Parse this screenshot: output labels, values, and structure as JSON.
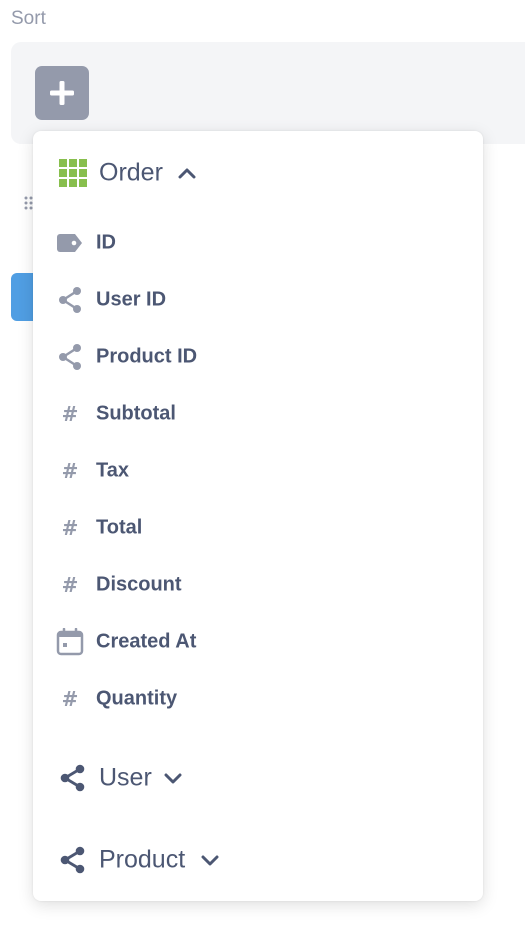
{
  "sort": {
    "label": "Sort",
    "add_button_icon": "plus-icon"
  },
  "colors": {
    "text_primary": "#4c5773",
    "text_muted": "#949aab",
    "table_icon": "#88bf4d",
    "accent_blue": "#509ee3",
    "panel_bg": "#f4f5f7"
  },
  "popover": {
    "sections": [
      {
        "name": "Order",
        "icon": "table-grid-icon",
        "expanded": true,
        "fields": [
          {
            "label": "ID",
            "icon": "tag-icon"
          },
          {
            "label": "User ID",
            "icon": "connections-icon"
          },
          {
            "label": "Product ID",
            "icon": "connections-icon"
          },
          {
            "label": "Subtotal",
            "icon": "hash-icon"
          },
          {
            "label": "Tax",
            "icon": "hash-icon"
          },
          {
            "label": "Total",
            "icon": "hash-icon"
          },
          {
            "label": "Discount",
            "icon": "hash-icon"
          },
          {
            "label": "Created At",
            "icon": "calendar-icon"
          },
          {
            "label": "Quantity",
            "icon": "hash-icon"
          }
        ]
      },
      {
        "name": "User",
        "icon": "connections-icon",
        "expanded": false,
        "fields": []
      },
      {
        "name": "Product",
        "icon": "connections-icon",
        "expanded": false,
        "fields": []
      }
    ]
  }
}
